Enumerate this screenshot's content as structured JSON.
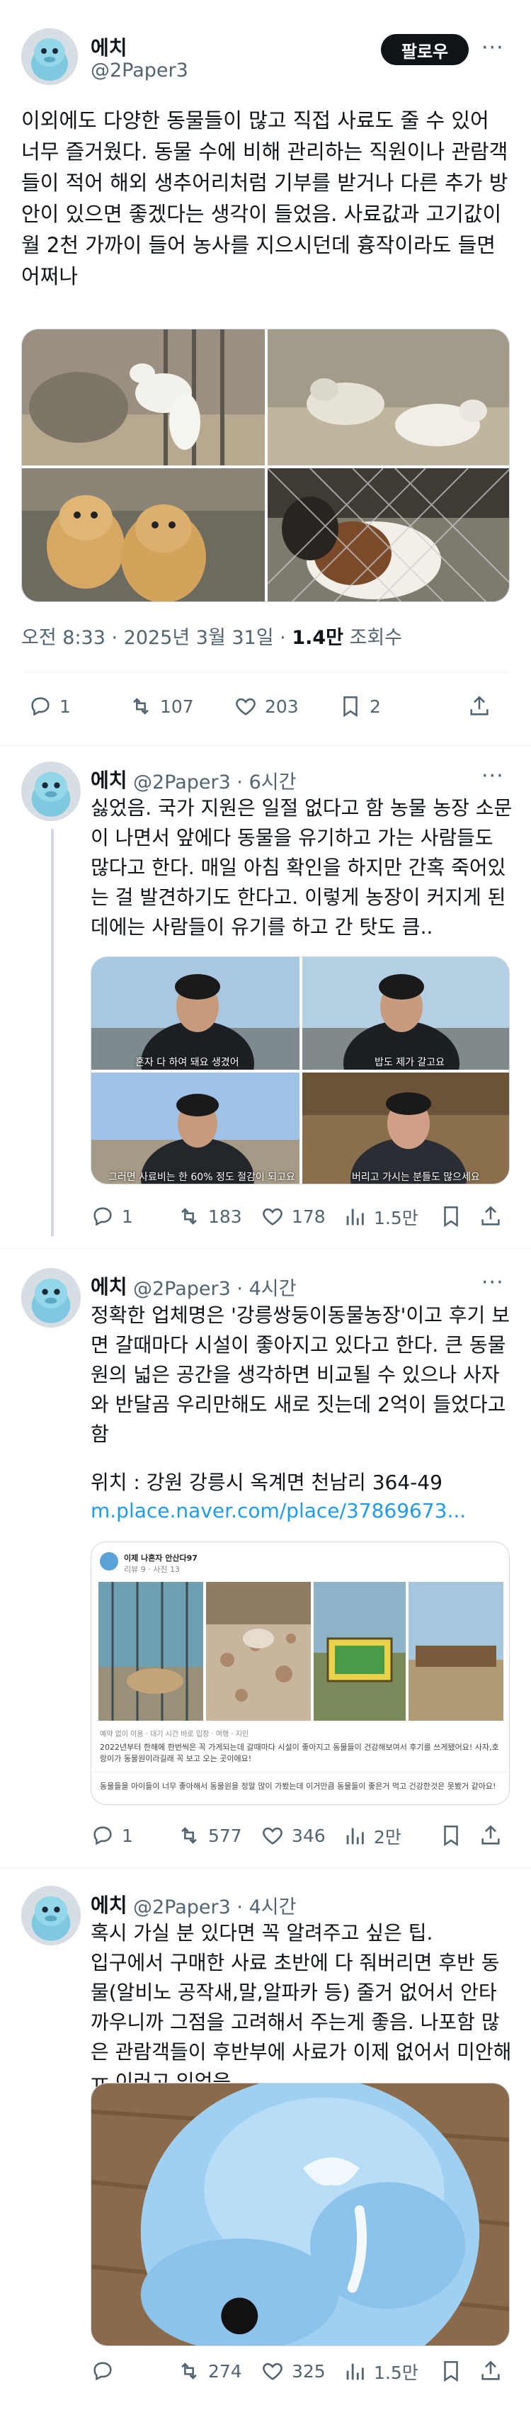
{
  "main_tweet": {
    "author_name": "에치",
    "author_handle": "@2Paper3",
    "follow_label": "팔로우",
    "more": "···",
    "text": "이외에도 다양한 동물들이 많고 직접 사료도 줄 수 있어 너무 즐거웠다. 동물 수에 비해 관리하는 직원이나 관람객들이 적어 해외 생추어리처럼 기부를 받거나 다른 추가 방안이 있으면 좋겠다는 생각이 들었음. 사료값과 고기값이 월 2천 가까이 들어 농사를 지으시던데 흉작이라도 들면 어쩌나",
    "timestamp": "오전 8:33 · 2025년 3월 31일 · ",
    "views_count": "1.4만",
    "views_label": " 조회수",
    "stats": {
      "replies": "1",
      "retweets": "107",
      "likes": "203",
      "bookmarks": "2"
    }
  },
  "replies": [
    {
      "author_name": "에치",
      "author_handle": "@2Paper3 · 6시간",
      "more": "···",
      "text": "싫었음. 국가 지원은 일절 없다고 함 농물 농장 소문이 나면서 앞에다 동물을 유기하고 가는 사람들도 많다고 한다. 매일 아침 확인을 하지만 간혹 죽어있는 걸 발견하기도 한다고. 이렇게 농장이 커지게 된데에는 사람들이 유기를 하고 간 탓도 큼..",
      "image_captions": [
        "혼자 다 하여 돼요 생겼어",
        "밥도 제가 갈고요",
        "그러면 사료비는 한 60% 정도 절감이 되고요",
        "버리고 가시는 분들도 많으세요"
      ],
      "stats": {
        "replies": "1",
        "retweets": "183",
        "likes": "178",
        "views": "1.5만"
      }
    },
    {
      "author_name": "에치",
      "author_handle": "@2Paper3 · 4시간",
      "more": "···",
      "text": "정확한 업체명은 '강릉쌍둥이동물농장'이고 후기 보면 갈때마다 시설이 좋아지고 있다고 한다. 큰 동물원의 넓은 공간을 생각하면 비교될 수 있으나 사자와 반달곰 우리만해도 새로 짓는데 2억이 들었다고 함",
      "location": "위치 : 강원 강릉시 옥계면 천남리 364-49",
      "link": "m.place.naver.com/place/37869673...",
      "card": {
        "reviewer": "이제 나혼자 안산다97",
        "reviewer_meta": "리뷰 9 · 사진 13",
        "meta_line": "예약 없이 이용 · 대기 시간 바로 입장 · 여행 · 지인",
        "review_text": "2022년부터 한해에 한번씩은 꼭 가게되는데 갈때마다 시설이 좋아지고 동물들이 건강해보여서 후기를 쓰게됐어요! 사자,호랑이가 동물원이라길래 꼭 보고 오는 곳이에요!",
        "bottom_text": "동물들을 아이들이 너무 좋아해서 동물원을 정말 많이 가봤는데 이거만큼 동물들이 좋은거 먹고 건강한것은 못봤거 같아요!"
      },
      "stats": {
        "replies": "1",
        "retweets": "577",
        "likes": "346",
        "views": "2만"
      }
    },
    {
      "author_name": "에치",
      "author_handle": "@2Paper3 · 4시간",
      "more": "···",
      "text": "혹시 가실 분 있다면 꼭 알려주고 싶은 팁.\n입구에서 구매한 사료 초반에 다 줘버리면 후반 동물(알비노 공작새,말,알파카 등) 줄거 없어서 안타까우니까 그점을 고려해서 주는게 좋음. 나포함 많은 관람객들이 후반부에 사료가 이제 없어서 미안해ㅠ 이러고 있었음",
      "stats": {
        "replies": "",
        "retweets": "274",
        "likes": "325",
        "views": "1.5만"
      }
    }
  ],
  "colors": {
    "accent": "#1d9bf0",
    "text": "#0f1419",
    "muted": "#536471",
    "border": "#cfd9de"
  },
  "icons": [
    "reply-icon",
    "retweet-icon",
    "like-icon",
    "bookmark-icon",
    "share-icon",
    "views-icon",
    "more-icon"
  ]
}
